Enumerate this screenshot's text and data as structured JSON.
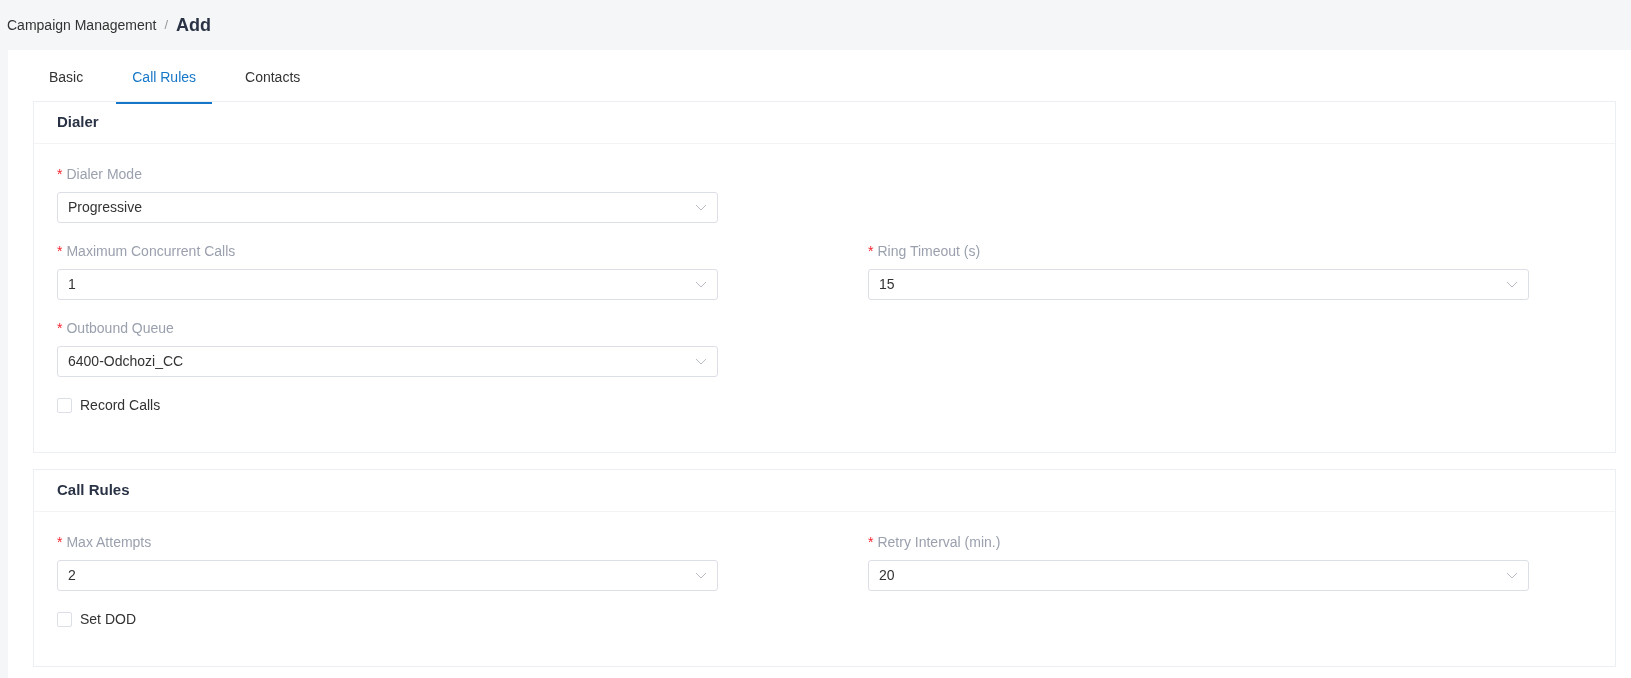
{
  "breadcrumb_separator": "/",
  "breadcrumb": [
    {
      "label": "Campaign Management",
      "current": false
    },
    {
      "label": "Add",
      "current": true
    }
  ],
  "tabs": [
    {
      "label": "Basic",
      "selected": false
    },
    {
      "label": "Call Rules",
      "selected": true
    },
    {
      "label": "Contacts",
      "selected": false
    }
  ],
  "sections": [
    {
      "title": "Dialer",
      "rows": [
        [
          {
            "kind": "select",
            "required_mark": "*",
            "label": "Dialer Mode",
            "value": "Progressive"
          }
        ],
        [
          {
            "kind": "select",
            "required_mark": "*",
            "label": "Maximum Concurrent Calls",
            "value": "1"
          },
          {
            "kind": "select",
            "required_mark": "*",
            "label": "Ring Timeout (s)",
            "value": "15"
          }
        ],
        [
          {
            "kind": "select",
            "required_mark": "*",
            "label": "Outbound Queue",
            "value": "6400-Odchozi_CC"
          }
        ],
        [
          {
            "kind": "checkbox",
            "label": "Record Calls",
            "checked": false
          }
        ]
      ]
    },
    {
      "title": "Call Rules",
      "rows": [
        [
          {
            "kind": "select",
            "required_mark": "*",
            "label": "Max Attempts",
            "value": "2"
          },
          {
            "kind": "select",
            "required_mark": "*",
            "label": "Retry Interval (min.)",
            "value": "20"
          }
        ],
        [
          {
            "kind": "checkbox",
            "label": "Set DOD",
            "checked": false
          }
        ]
      ]
    }
  ]
}
